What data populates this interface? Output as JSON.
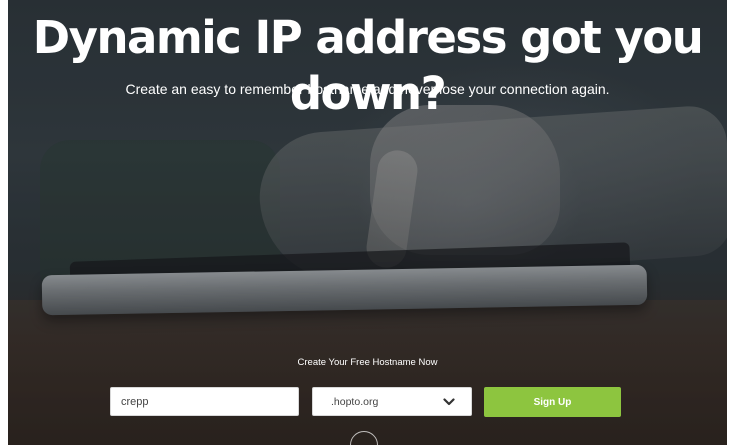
{
  "hero": {
    "title": "Dynamic IP address got you down?",
    "subtitle": "Create an easy to remember hostname and never lose your connection again."
  },
  "form": {
    "label": "Create Your Free Hostname Now",
    "hostname_value": "crepp",
    "domain_selected": ".hopto.org",
    "signup_label": "Sign Up"
  },
  "colors": {
    "accent": "#8dc53f",
    "text": "#ffffff"
  },
  "icons": {
    "select": "chevron-down-icon",
    "scroll": "scroll-down-icon"
  }
}
